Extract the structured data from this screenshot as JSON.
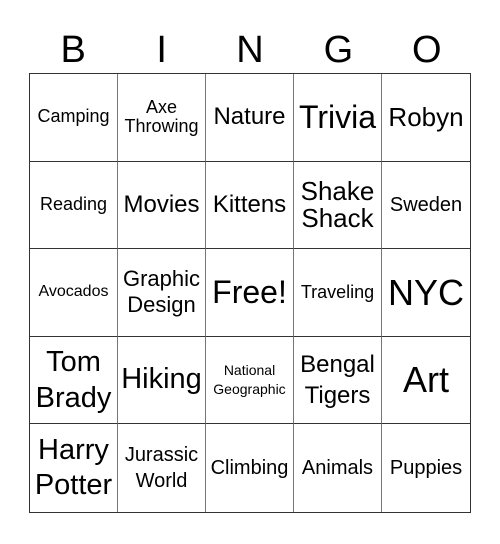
{
  "header": {
    "letters": [
      "B",
      "I",
      "N",
      "G",
      "O"
    ]
  },
  "card": {
    "rows": [
      [
        "Camping",
        "Axe Throwing",
        "Nature",
        "Trivia",
        "Robyn"
      ],
      [
        "Reading",
        "Movies",
        "Kittens",
        "Shake Shack",
        "Sweden"
      ],
      [
        "Avocados",
        "Graphic Design",
        "Free!",
        "Traveling",
        "NYC"
      ],
      [
        "Tom Brady",
        "Hiking",
        "National Geographic",
        "Bengal Tigers",
        "Art"
      ],
      [
        "Harry Potter",
        "Jurassic World",
        "Climbing",
        "Animals",
        "Puppies"
      ]
    ],
    "free_space": "Free!"
  }
}
